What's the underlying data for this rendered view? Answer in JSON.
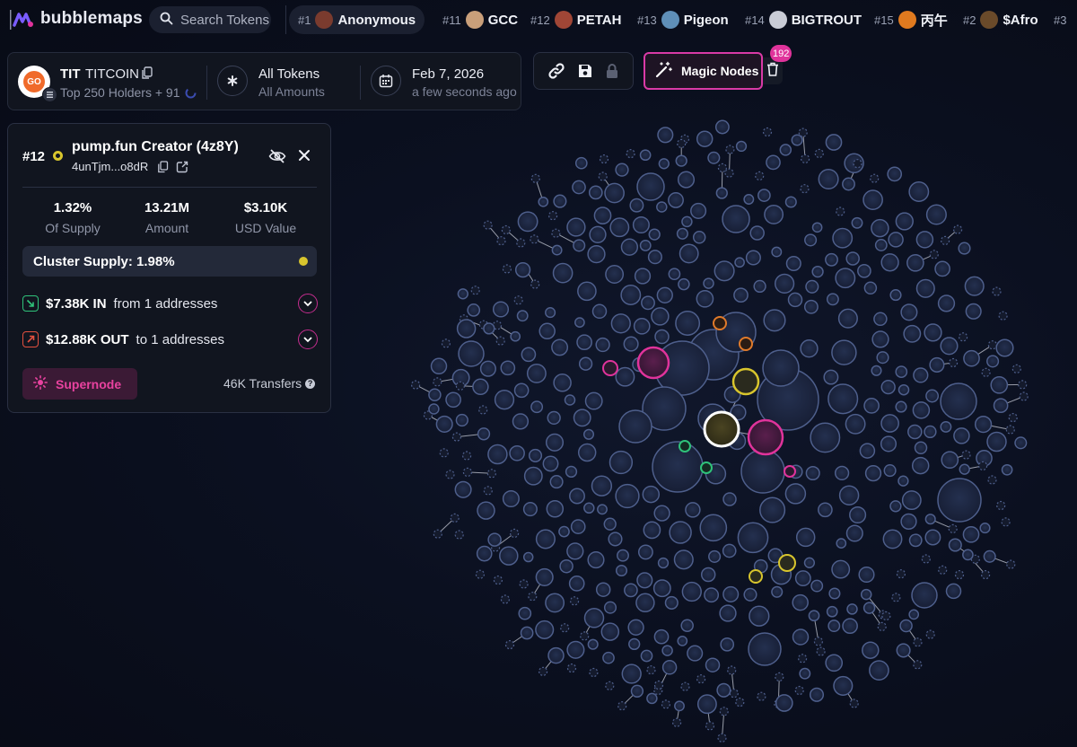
{
  "app": {
    "brand": "bubblemaps"
  },
  "search": {
    "placeholder": "Search Tokens"
  },
  "trending": [
    {
      "rank": "#1",
      "name": "Anonymous",
      "avatar": "#7a3b2e"
    },
    {
      "rank": "#11",
      "name": "GCC",
      "avatar": "#c99f7a"
    },
    {
      "rank": "#12",
      "name": "PETAH",
      "avatar": "#a04636"
    },
    {
      "rank": "#13",
      "name": "Pigeon",
      "avatar": "#5f8fb8"
    },
    {
      "rank": "#14",
      "name": "BIGTROUT",
      "avatar": "#c9ccd6"
    },
    {
      "rank": "#15",
      "name": "丙午",
      "avatar": "#e07a1f"
    },
    {
      "rank": "#2",
      "name": "$Afro",
      "avatar": "#6a4a2a"
    },
    {
      "rank": "#3",
      "name": "",
      "avatar": ""
    }
  ],
  "token": {
    "symbol": "TIT",
    "name": "TITCOIN",
    "avatar_text": "GO",
    "holders": "Top 250 Holders + 91",
    "filter_title": "All Tokens",
    "filter_sub": "All Amounts",
    "date": "Feb 7, 2026",
    "date_sub": "a few seconds ago"
  },
  "toolbar": {
    "magic_label": "Magic Nodes",
    "badge": "192",
    "icons": [
      "link-icon",
      "save-icon",
      "lock-icon",
      "trash-icon"
    ]
  },
  "panel": {
    "rank": "#12",
    "title": "pump.fun Creator (4z8Y)",
    "address": "4unTjm...o8dR",
    "stats": [
      {
        "value": "1.32%",
        "label": "Of Supply"
      },
      {
        "value": "13.21M",
        "label": "Amount"
      },
      {
        "value": "$3.10K",
        "label": "USD Value"
      }
    ],
    "cluster": "Cluster Supply: 1.98%",
    "in_amount": "$7.38K IN",
    "in_rest": "from 1 addresses",
    "out_amount": "$12.88K OUT",
    "out_rest": "to 1 addresses",
    "supernode": "Supernode",
    "transfers": "46K Transfers"
  },
  "colors": {
    "accent_pink": "#e0339b",
    "selected_yellow": "#d8c52d",
    "in_green": "#2fc27a",
    "out_red": "#e2503f",
    "bubble_fill": "#1b2440",
    "bubble_stroke": "#4e5f8c"
  }
}
